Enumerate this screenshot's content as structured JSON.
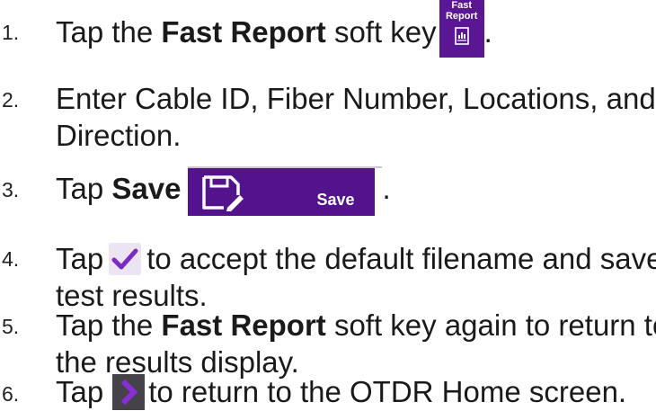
{
  "steps": [
    {
      "num": "1.",
      "pre": "Tap the ",
      "bold": "Fast Report",
      "post": " soft key",
      "tail": ".",
      "softkey": {
        "line1": "Fast",
        "line2": "Report",
        "icon": "report-document-icon"
      }
    },
    {
      "num": "2.",
      "line1": "Enter Cable ID, Fiber Number, Locations, and",
      "line2": "Direction."
    },
    {
      "num": "3.",
      "pre": "Tap ",
      "bold": "Save",
      "tail": ".",
      "button": {
        "label": "Save",
        "icon": "save-floppy-edit-icon"
      }
    },
    {
      "num": "4.",
      "pre": "Tap",
      "post": "to accept the default filename and save",
      "line2": "test results.",
      "icon": "checkmark-icon"
    },
    {
      "num": "5.",
      "pre": "Tap the ",
      "bold": "Fast Report",
      "post": " soft key again to return to",
      "line2": "the results display."
    },
    {
      "num": "6.",
      "pre": "Tap",
      "post": "to return to the OTDR Home screen.",
      "icon": "chevron-right-icon"
    }
  ],
  "colors": {
    "softkey_bg": "#5b1793",
    "button_bg": "#53138c",
    "accent_purple": "#7a2cc0",
    "chevron_bg": "#45424a"
  }
}
